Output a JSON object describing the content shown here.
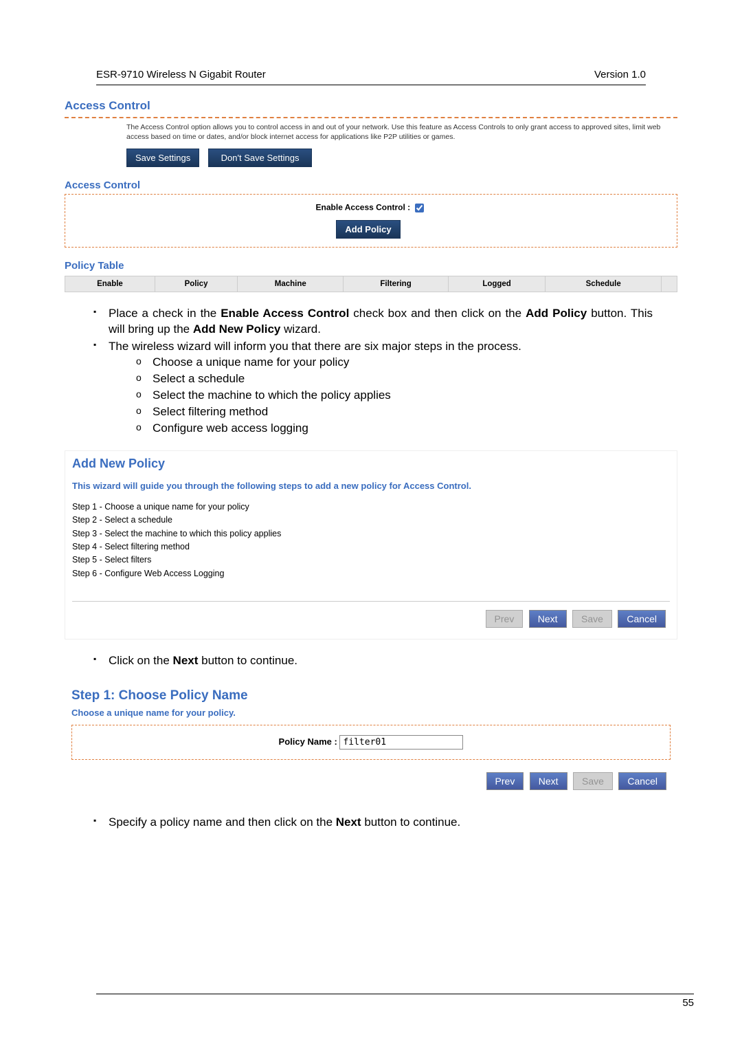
{
  "doc": {
    "title_left": "ESR-9710 Wireless N Gigabit Router",
    "title_right": "Version 1.0",
    "page_number": "55"
  },
  "access_control": {
    "title": "Access Control",
    "description": "The Access Control option allows you to control access in and out of your network. Use this feature as Access Controls to only grant access to approved sites, limit web access based on time or dates, and/or block internet access for applications like P2P utilities or games.",
    "save_btn": "Save Settings",
    "dont_save_btn": "Don't Save Settings",
    "sub_title": "Access Control",
    "enable_label": "Enable Access Control :",
    "add_policy_btn": "Add Policy",
    "policy_table_title": "Policy Table",
    "cols": {
      "enable": "Enable",
      "policy": "Policy",
      "machine": "Machine",
      "filtering": "Filtering",
      "logged": "Logged",
      "schedule": "Schedule"
    }
  },
  "manual": {
    "li1_pre": "Place a check in the ",
    "li1_b1": "Enable Access Control",
    "li1_mid": " check box and then click on the ",
    "li1_b2": "Add Policy",
    "li1_mid2": " button. This will bring up the ",
    "li1_b3": "Add New Policy",
    "li1_end": " wizard.",
    "li2": "The wireless wizard will inform you that there are six major steps in the process.",
    "sub": {
      "s1": "Choose a unique name for your policy",
      "s2": "Select a schedule",
      "s3": "Select the machine to which the policy applies",
      "s4": "Select filtering method",
      "s5": "Configure web access logging"
    },
    "li3_pre": "Click on the ",
    "li3_b": "Next",
    "li3_end": " button to continue.",
    "li4_pre": "Specify a policy name and then click on the ",
    "li4_b": "Next",
    "li4_end": " button to continue."
  },
  "wizard": {
    "title": "Add New Policy",
    "intro": "This wizard will guide you through the following steps to add a new policy for Access Control.",
    "step1": "Step 1 - Choose a unique name for your policy",
    "step2": "Step 2 - Select a schedule",
    "step3": "Step 3 - Select the machine to which this policy applies",
    "step4": "Step 4 - Select filtering method",
    "step5": "Step 5 - Select filters",
    "step6": "Step 6 - Configure Web Access Logging",
    "btn_prev": "Prev",
    "btn_next": "Next",
    "btn_save": "Save",
    "btn_cancel": "Cancel"
  },
  "step1": {
    "title": "Step 1: Choose Policy Name",
    "subtitle": "Choose a unique name for your policy.",
    "label": "Policy Name :",
    "value": "filter01"
  }
}
